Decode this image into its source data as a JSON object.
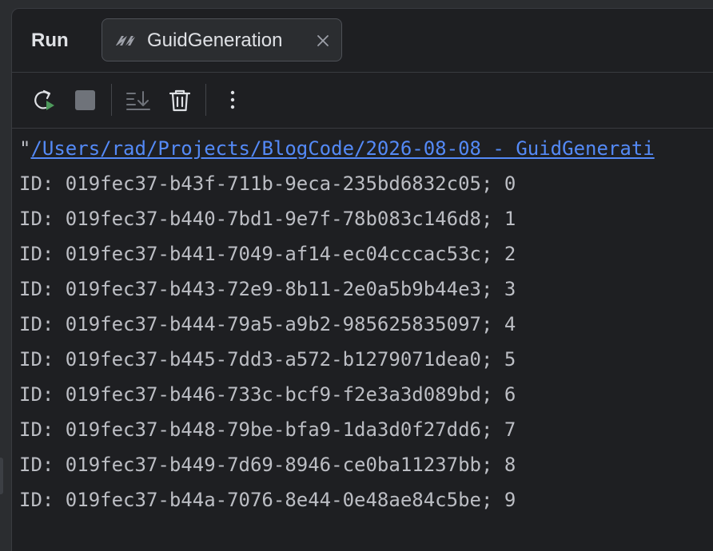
{
  "header": {
    "title": "Run",
    "tab": {
      "label": "GuidGeneration",
      "icon": "dotnet-run-config-icon"
    }
  },
  "toolbar": {
    "buttons": [
      {
        "icon": "rerun-icon",
        "color": "#4e9a5c"
      },
      {
        "icon": "stop-icon",
        "color": "#6f737a"
      },
      {
        "icon": "scroll-to-end-icon"
      },
      {
        "icon": "clear-all-icon"
      },
      {
        "icon": "more-vertical-icon"
      }
    ]
  },
  "console": {
    "command_quote": "\"",
    "command_path": "/Users/rad/Projects/BlogCode/2026-08-08 - GuidGenerati",
    "lines": [
      "ID: 019fec37-b43f-711b-9eca-235bd6832c05; 0",
      "ID: 019fec37-b440-7bd1-9e7f-78b083c146d8; 1",
      "ID: 019fec37-b441-7049-af14-ec04cccac53c; 2",
      "ID: 019fec37-b443-72e9-8b11-2e0a5b9b44e3; 3",
      "ID: 019fec37-b444-79a5-a9b2-985625835097; 4",
      "ID: 019fec37-b445-7dd3-a572-b1279071dea0; 5",
      "ID: 019fec37-b446-733c-bcf9-f2e3a3d089bd; 6",
      "ID: 019fec37-b448-79be-bfa9-1da3d0f27dd6; 7",
      "ID: 019fec37-b449-7d69-8946-ce0ba11237bb; 8",
      "ID: 019fec37-b44a-7076-8e44-0e48ae84c5be; 9"
    ]
  },
  "colors": {
    "background": "#1e1f22",
    "text": "#bcbec4",
    "link": "#548af7",
    "run_green": "#4e9a5c"
  }
}
